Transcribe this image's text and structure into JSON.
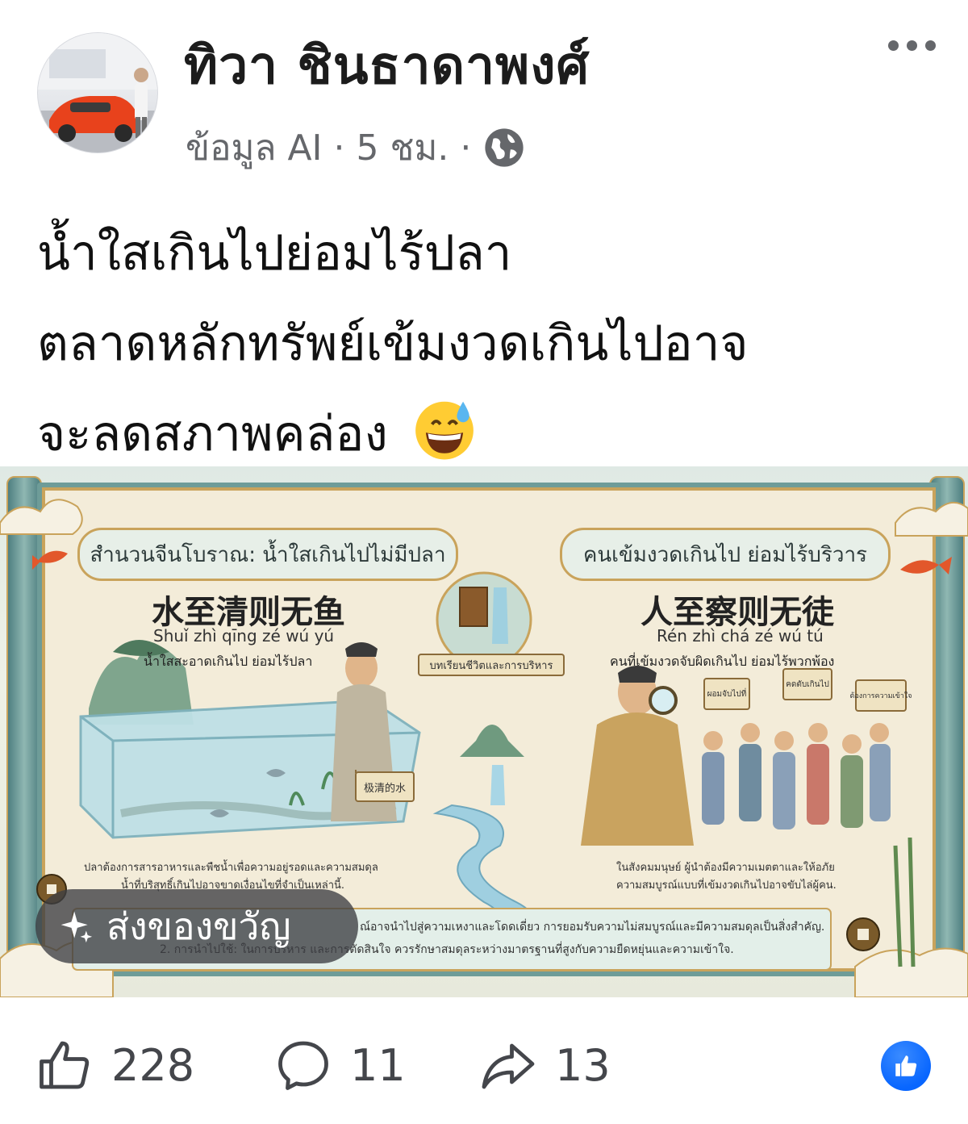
{
  "post": {
    "author": "ทิวา ชินธาดาพงศ์",
    "meta": {
      "source_label": "ข้อมูล AI",
      "separator": "·",
      "time": "5 ชม.",
      "audience_icon": "globe-icon"
    },
    "more_icon": "more-options-icon",
    "caption_lines": [
      "น้ำใสเกินไปย่อมไร้ปลา",
      "ตลาดหลักทรัพย์เข้มงวดเกินไปอาจ",
      "จะลดสภาพคล่อง"
    ],
    "caption_emoji": "grinning-sweat-emoji"
  },
  "image": {
    "left_banner": "สำนวนจีนโบราณ: น้ำใสเกินไปไม่มีปลา",
    "right_banner": "คนเข้มงวดเกินไป ย่อมไร้บริวาร",
    "left_hanzi": "水至清则无鱼",
    "left_pinyin": "Shuǐ zhì qīng zé wú yú",
    "left_thai": "น้ำใสสะอาดเกินไป ย่อมไร้ปลา",
    "right_hanzi": "人至察则无徒",
    "right_pinyin": "Rén zhì chá zé wú tú",
    "right_thai": "คนที่เข้มงวดจับผิดเกินไป ย่อมไร้พวกพ้อง",
    "center_label": "บทเรียนชีวิตและการบริหาร",
    "water_sign": "极清的水",
    "left_note_1": "ปลาต้องการสารอาหารและพืชน้ำเพื่อความอยู่รอดและความสมดุล",
    "left_note_2": "น้ำที่บริสุทธิ์เกินไปอาจขาดเงื่อนไขที่จำเป็นเหล่านี้.",
    "right_note_1": "ในสังคมมนุษย์ ผู้นำต้องมีความเมตตาและให้อภัย",
    "right_note_2": "ความสมบูรณ์แบบที่เข้มงวดเกินไปอาจขับไล่ผู้คน.",
    "bottom_line_1": "ณ์อาจนำไปสู่ความเหงาและโดดเดี่ยว การยอมรับความไม่สมบูรณ์และมีความสมดุลเป็นสิ่งสำคัญ.",
    "bottom_line_2": "2. การนำไปใช้: ในการบริหาร และการตัดสินใจ ควรรักษาสมดุลระหว่างมาตรฐานที่สูงกับความยืดหยุ่นและความเข้าใจ.",
    "signs": [
      "ผอมจับไปที่",
      "คดตับเกินไป",
      "ต้องการความเข้าใจ"
    ]
  },
  "gift_button": {
    "label": "ส่งของขวัญ",
    "icon": "sparkle-icon"
  },
  "actions": {
    "like_count": "228",
    "comment_count": "11",
    "share_count": "13",
    "like_icon": "thumbs-up-icon",
    "comment_icon": "comment-bubble-icon",
    "share_icon": "share-arrow-icon",
    "reaction_icon": "like-reaction-icon"
  },
  "colors": {
    "meta_gray": "#65676b",
    "like_blue": "#0866ff",
    "scroll_teal": "#6e9c98",
    "scroll_gold": "#c9a35b",
    "parchment": "#f3ecd9"
  }
}
